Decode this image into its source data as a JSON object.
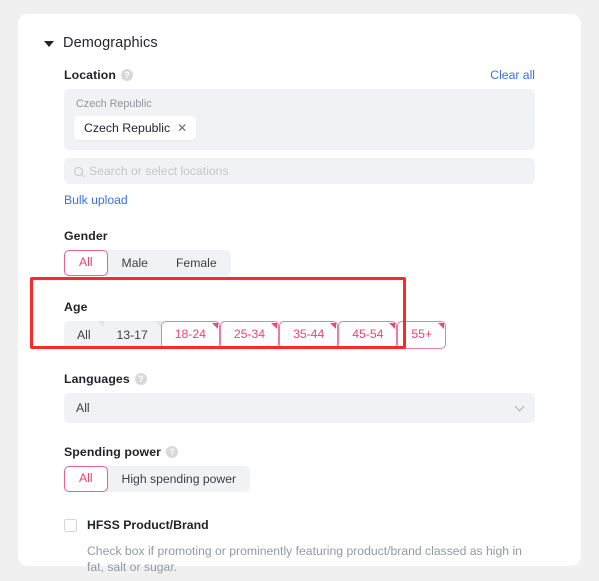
{
  "section": {
    "title": "Demographics",
    "caret_icon": "caret-down-icon",
    "expanded": true
  },
  "location": {
    "label": "Location",
    "help_icon": "question-mark-icon",
    "clear_all_label": "Clear all",
    "group_label": "Czech Republic",
    "chips": [
      {
        "label": "Czech Republic",
        "remove_icon": "close-x-icon"
      }
    ],
    "search_icon": "search-icon",
    "search_placeholder": "Search or select locations",
    "search_value": "",
    "bulk_upload_label": "Bulk upload"
  },
  "gender": {
    "label": "Gender",
    "options": [
      {
        "label": "All",
        "selected": true
      },
      {
        "label": "Male",
        "selected": false
      },
      {
        "label": "Female",
        "selected": false
      }
    ]
  },
  "age": {
    "label": "Age",
    "options": [
      {
        "label": "All",
        "selected": false
      },
      {
        "label": "13-17",
        "selected": false
      },
      {
        "label": "18-24",
        "selected": true
      },
      {
        "label": "25-34",
        "selected": true
      },
      {
        "label": "35-44",
        "selected": true
      },
      {
        "label": "45-54",
        "selected": true
      },
      {
        "label": "55+",
        "selected": true
      }
    ],
    "highlighted": true
  },
  "languages": {
    "label": "Languages",
    "help_icon": "question-mark-icon",
    "value": "All",
    "chevron_icon": "chevron-down-icon"
  },
  "spending_power": {
    "label": "Spending power",
    "help_icon": "question-mark-icon",
    "options": [
      {
        "label": "All",
        "selected": true
      },
      {
        "label": "High spending power",
        "selected": false
      }
    ]
  },
  "hfss": {
    "label": "HFSS Product/Brand",
    "checked": false,
    "help_text": "Check box if promoting or prominently featuring product/brand classed as high in fat, salt or sugar."
  },
  "colors": {
    "accent_pink": "#ef4276",
    "accent_pink_border": "#f07aa0",
    "link_blue": "#3b6fe0",
    "annotation_red": "#fa2a2a",
    "field_bg": "#f1f2f4",
    "page_bg": "#f0f0f0"
  }
}
